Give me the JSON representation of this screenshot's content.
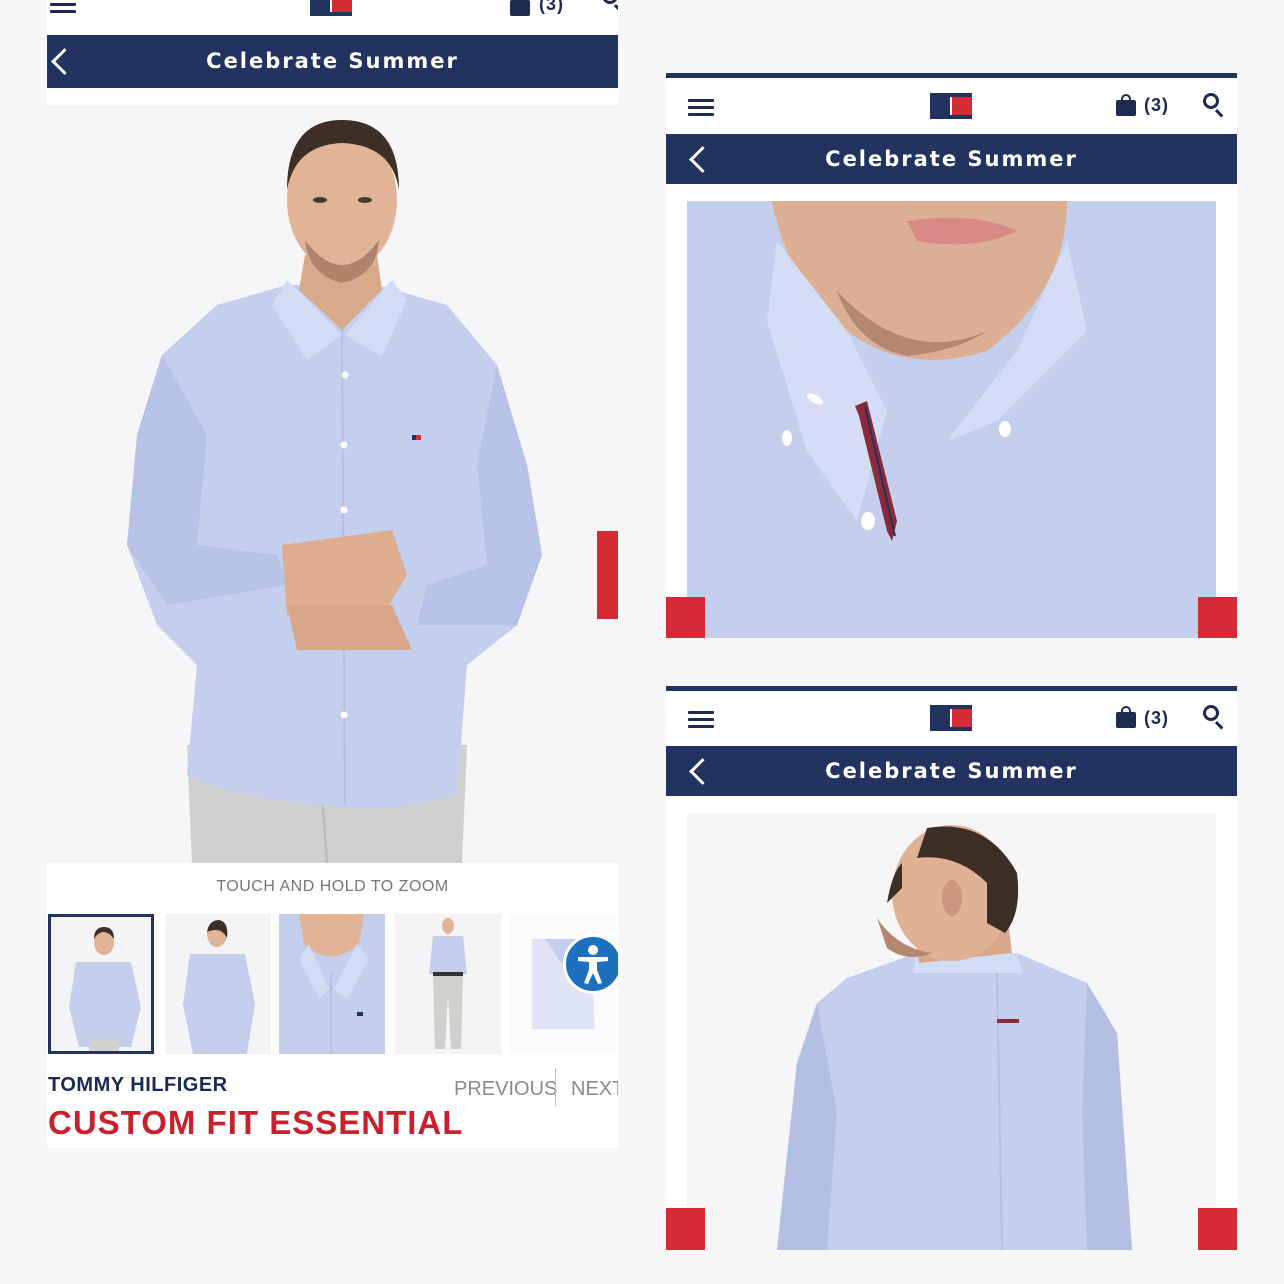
{
  "header": {
    "cart_count": "(3)",
    "title": "Celebrate Summer"
  },
  "gallery": {
    "hint": "TOUCH AND HOLD TO ZOOM",
    "thumbnails": [
      "front-view",
      "back-view",
      "collar-detail",
      "full-length",
      "folded-shirt"
    ]
  },
  "product": {
    "brand": "TOMMY HILFIGER",
    "name": "CUSTOM FIT ESSENTIAL"
  },
  "pager": {
    "previous": "PREVIOUS",
    "next": "NEXT"
  },
  "colors": {
    "navy": "#23335f",
    "red": "#d42a35",
    "shirt": "#c4cfee"
  }
}
